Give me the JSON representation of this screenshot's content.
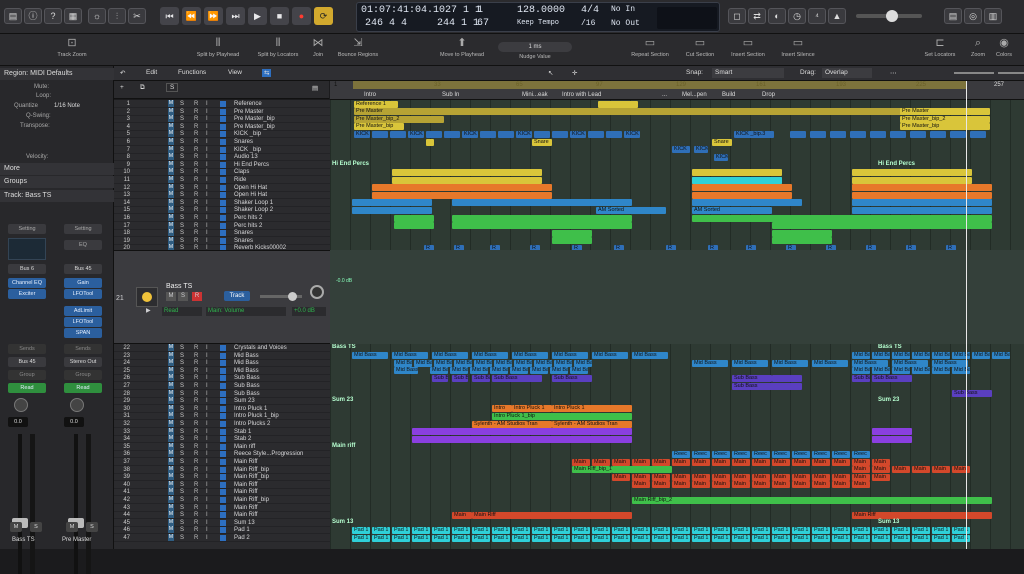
{
  "lcd": {
    "time": "01:07:41:04.10",
    "bars": "27 1 1",
    "beat_small": "1",
    "bar2": "246 4 4",
    "bars2": "244 1 1",
    "beat_small2": "67",
    "tempo": "128.0000",
    "tempo_mode": "Keep Tempo",
    "sig": "4/4",
    "div": "/16",
    "in": "No In",
    "out": "No Out"
  },
  "toolbar": {
    "track_zoom": "Track Zoom",
    "split_playhead": "Split by Playhead",
    "split_locators": "Split by Locators",
    "join": "Join",
    "bounce": "Bounce Regions",
    "move_playhead": "Move to Playhead",
    "nudge": "Nudge Value",
    "nudge_val": "1 ms",
    "repeat": "Repeat Section",
    "cut": "Cut Section",
    "insert": "Insert Section",
    "insert_silence": "Insert Silence",
    "set_locators": "Set Locators",
    "zoom": "Zoom",
    "colors": "Colors"
  },
  "menu": {
    "edit": "Edit",
    "functions": "Functions",
    "view": "View",
    "snap_label": "Snap:",
    "snap": "Smart",
    "drag_label": "Drag:",
    "drag": "Overlap"
  },
  "inspector": {
    "region": "Region: MIDI Defaults",
    "mute": "Mute:",
    "loop": "Loop:",
    "quantize": "Quantize",
    "quantize_val": "1/16 Note",
    "qswing": "Q-Swing:",
    "transpose": "Transpose:",
    "velocity": "Velocity:",
    "more": "More",
    "groups": "Groups",
    "track": "Track: Bass TS",
    "setting": "Setting",
    "eq": "EQ",
    "bus6": "Bus 6",
    "bus45": "Bus 45",
    "ch_eq": "Channel EQ",
    "exciter": "Exciter",
    "gain": "Gain",
    "lfotool": "LFOTool",
    "adlimit": "AdLimit",
    "lfotool2": "LFOTool",
    "span": "SPAN",
    "sends": "Sends",
    "bus45b": "Bus 45",
    "stereo_out": "Stereo Out",
    "group": "Group",
    "read": "Read",
    "vol1": "0.0",
    "vol2": "0.0",
    "m": "M",
    "s": "S",
    "name1": "Bass TS",
    "name2": "Pre Master"
  },
  "ruler": {
    "bars": [
      "1",
      "33",
      "65",
      "97",
      "129",
      "161",
      "193",
      "225",
      "257"
    ],
    "sections": [
      "Intro",
      "Sub In",
      "Mini...eak",
      "Intro with Lead",
      "...",
      "Mel...pen",
      "Build",
      "Drop"
    ]
  },
  "bigtrack": {
    "name": "Bass TS",
    "num": "21",
    "read": "Read",
    "param": "Main: Volume",
    "value": "+0.0 dB",
    "btn": "Track",
    "m": "M",
    "s": "S",
    "r": "R"
  },
  "tracks": [
    {
      "n": "1",
      "name": "Reference"
    },
    {
      "n": "2",
      "name": "Pre Master"
    },
    {
      "n": "3",
      "name": "Pre Master_bip"
    },
    {
      "n": "4",
      "name": "Pre Master_bip"
    },
    {
      "n": "5",
      "name": "KICK _bip"
    },
    {
      "n": "6",
      "name": "Snares"
    },
    {
      "n": "7",
      "name": "KICK _bip"
    },
    {
      "n": "8",
      "name": "Audio 13"
    },
    {
      "n": "9",
      "name": "Hi End Percs"
    },
    {
      "n": "10",
      "name": "Claps"
    },
    {
      "n": "11",
      "name": "Ride"
    },
    {
      "n": "12",
      "name": "Open Hi Hat"
    },
    {
      "n": "13",
      "name": "Open Hi Hat"
    },
    {
      "n": "14",
      "name": "Shaker Loop 1"
    },
    {
      "n": "15",
      "name": "Shaker Loop 2"
    },
    {
      "n": "16",
      "name": "Perc hits 2"
    },
    {
      "n": "17",
      "name": "Perc hits 2"
    },
    {
      "n": "18",
      "name": "Snares"
    },
    {
      "n": "19",
      "name": "Snares"
    },
    {
      "n": "20",
      "name": "Reverb Kicks00002"
    },
    {
      "n": "22",
      "name": "Crystals and Voices"
    },
    {
      "n": "23",
      "name": "Mid Bass"
    },
    {
      "n": "24",
      "name": "Mid Bass"
    },
    {
      "n": "25",
      "name": "Mid Bass"
    },
    {
      "n": "26",
      "name": "Sub Bass"
    },
    {
      "n": "27",
      "name": "Sub Bass"
    },
    {
      "n": "28",
      "name": "Sub Bass"
    },
    {
      "n": "29",
      "name": "Sum 23"
    },
    {
      "n": "30",
      "name": "Intro Pluck 1"
    },
    {
      "n": "31",
      "name": "Intro Pluck 1_bip"
    },
    {
      "n": "32",
      "name": "Intro Plucks 2"
    },
    {
      "n": "33",
      "name": "Stab 1"
    },
    {
      "n": "34",
      "name": "Stab 2"
    },
    {
      "n": "35",
      "name": "Main riff"
    },
    {
      "n": "36",
      "name": "Reece Style...Progression"
    },
    {
      "n": "37",
      "name": "Main Riff"
    },
    {
      "n": "38",
      "name": "Main Riff_bip"
    },
    {
      "n": "39",
      "name": "Main Riff_bip"
    },
    {
      "n": "40",
      "name": "Main Riff"
    },
    {
      "n": "41",
      "name": "Main Riff"
    },
    {
      "n": "42",
      "name": "Main Riff_bip"
    },
    {
      "n": "43",
      "name": "Main Riff"
    },
    {
      "n": "44",
      "name": "Main Riff"
    },
    {
      "n": "45",
      "name": "Sum 13"
    },
    {
      "n": "46",
      "name": "Pad 1"
    },
    {
      "n": "47",
      "name": "Pad 2"
    }
  ],
  "regions": {
    "reference": "Reference 1",
    "pre_master": "Pre Master",
    "pre_master_bip2": "Pre Master_bip_2",
    "pre_master_bip": "Pre Master_bip",
    "kick": "KICK",
    "kick_bip3": "KICK _bip.3",
    "snare": "Snare",
    "hi_end": "Hi End Percs",
    "am_sorted": "AM Sorted",
    "bass_ts": "Bass TS",
    "mid_bass": "Mid Bass",
    "sub_bass": "Sub Bass",
    "sum23": "Sum 23",
    "intro_pluck": "Intro Pluck 1",
    "intro_pluck_bip": "Intro Pluck 1_bip",
    "sylenth": "Sylenth - AM Studios Tran",
    "main_riff": "Main riff",
    "reec": "Reec",
    "main_riff_bip": "Main Riff_bip_1",
    "main_riff_bip2": "Main Riff_bip_2",
    "main": "Main",
    "main_riff2": "Main Riff",
    "sum13": "Sum 13",
    "pad": "Pad 1",
    "intro": "Intro",
    "r": "R",
    "db": "-0.0 dB"
  },
  "colors": {
    "accent": "#f0c23a",
    "blue": "#2d6fc1",
    "green": "#2fa44b"
  }
}
